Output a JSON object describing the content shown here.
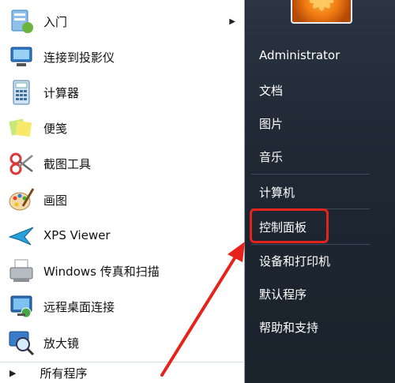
{
  "left_items": [
    {
      "label": "入门",
      "icon": "getting-started-icon",
      "has_submenu": true
    },
    {
      "label": "连接到投影仪",
      "icon": "projector-icon"
    },
    {
      "label": "计算器",
      "icon": "calculator-icon"
    },
    {
      "label": "便笺",
      "icon": "sticky-notes-icon"
    },
    {
      "label": "截图工具",
      "icon": "snipping-tool-icon"
    },
    {
      "label": "画图",
      "icon": "paint-icon"
    },
    {
      "label": "XPS Viewer",
      "icon": "xps-viewer-icon"
    },
    {
      "label": "Windows 传真和扫描",
      "icon": "fax-scan-icon"
    },
    {
      "label": "远程桌面连接",
      "icon": "remote-desktop-icon"
    },
    {
      "label": "放大镜",
      "icon": "magnifier-icon"
    }
  ],
  "all_programs": "所有程序",
  "submenu_arrow": "▶",
  "right_items": {
    "user": "Administrator",
    "documents": "文档",
    "pictures": "图片",
    "music": "音乐",
    "computer": "计算机",
    "control_panel": "控制面板",
    "devices": "设备和打印机",
    "default_programs": "默认程序",
    "help": "帮助和支持"
  },
  "colors": {
    "highlight": "#e6231b",
    "right_panel": "#1f2833",
    "left_panel": "#ffffff"
  }
}
